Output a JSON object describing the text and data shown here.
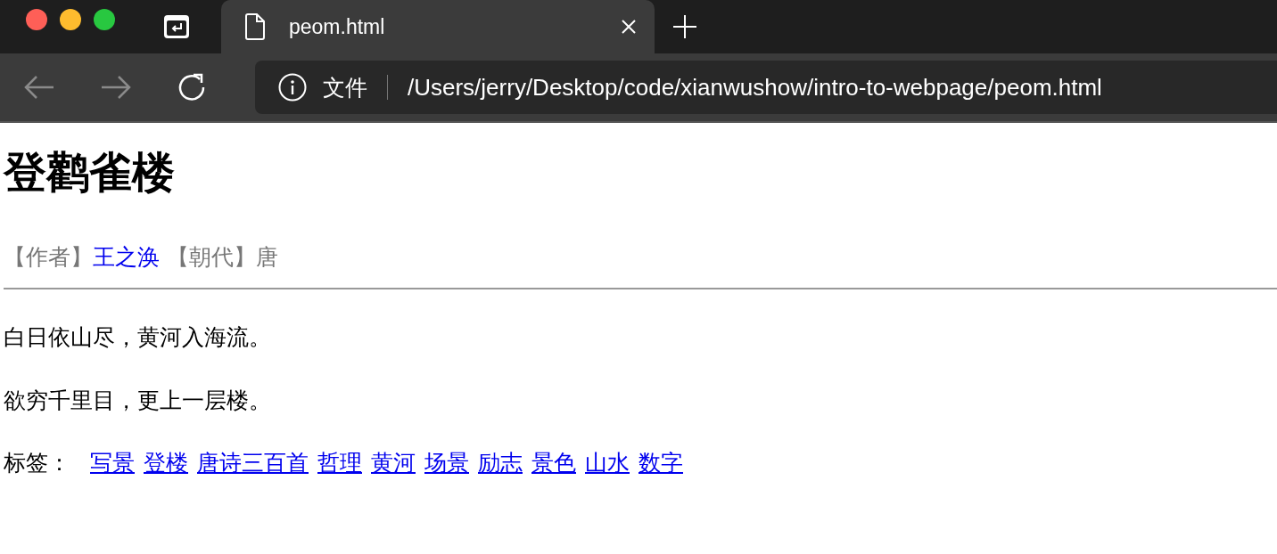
{
  "browser": {
    "tabs": [
      {
        "kind": "pinned",
        "selected": false
      },
      {
        "kind": "page",
        "label": "peom.html",
        "selected": true
      }
    ],
    "address": {
      "security_label": "文件",
      "url": "/Users/jerry/Desktop/code/xianwushow/intro-to-webpage/peom.html"
    }
  },
  "page": {
    "title": "登鹳雀楼",
    "meta": [
      {
        "label": "【作者】",
        "value": "王之涣",
        "kind": "link"
      },
      {
        "label": "【朝代】",
        "value": "唐",
        "kind": "text"
      }
    ],
    "lines": [
      "白日依山尽，黄河入海流。",
      "欲穷千里目，更上一层楼。"
    ],
    "tags_label": "标签：",
    "tags": [
      "写景",
      "登楼",
      "唐诗三百首",
      "哲理",
      "黄河",
      "场景",
      "励志",
      "景色",
      "山水",
      "数字"
    ]
  }
}
